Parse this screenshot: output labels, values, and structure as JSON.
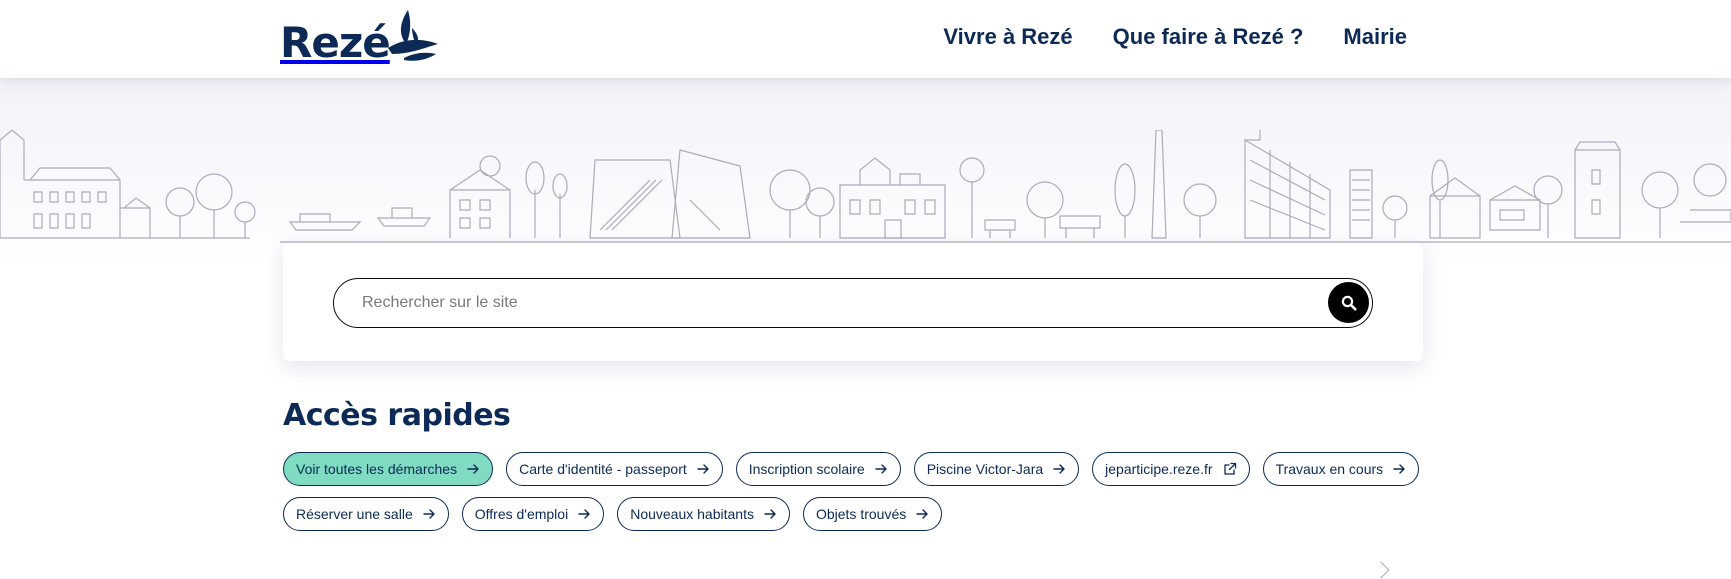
{
  "header": {
    "logo_text": "Rezé",
    "nav": [
      {
        "label": "Vivre à Rezé"
      },
      {
        "label": "Que faire à Rezé ?"
      },
      {
        "label": "Mairie"
      }
    ]
  },
  "search": {
    "placeholder": "Rechercher sur le site",
    "value": "",
    "button_icon": "search-icon"
  },
  "quick_access": {
    "title": "Accès rapides",
    "links": [
      {
        "label": "Voir toutes les démarches",
        "icon": "arrow-right-icon",
        "highlighted": true
      },
      {
        "label": "Carte d'identité - passeport",
        "icon": "arrow-right-icon"
      },
      {
        "label": "Inscription scolaire",
        "icon": "arrow-right-icon"
      },
      {
        "label": "Piscine Victor-Jara",
        "icon": "arrow-right-icon"
      },
      {
        "label": "jeparticipe.reze.fr",
        "icon": "external-link-icon"
      },
      {
        "label": "Travaux en cours",
        "icon": "arrow-right-icon"
      },
      {
        "label": "Réserver une salle",
        "icon": "arrow-right-icon"
      },
      {
        "label": "Offres d'emploi",
        "icon": "arrow-right-icon"
      },
      {
        "label": "Nouveaux habitants",
        "icon": "arrow-right-icon"
      },
      {
        "label": "Objets trouvés",
        "icon": "arrow-right-icon"
      }
    ]
  },
  "colors": {
    "brand_navy": "#0c2a55",
    "chip_highlight": "#7fdcc3",
    "search_button": "#000000"
  }
}
